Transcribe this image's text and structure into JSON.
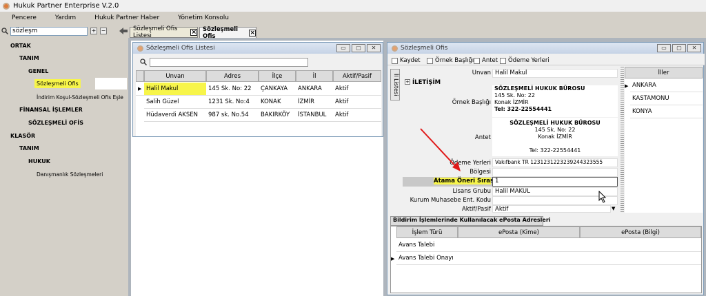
{
  "app": {
    "title": "Hukuk Partner Enterprise V.2.0"
  },
  "menu": [
    "Pencere",
    "Yardım",
    "Hukuk Partner Haber",
    "Yönetim Konsolu"
  ],
  "sidebar": {
    "search_value": "sözleşm",
    "expand_label": "+",
    "collapse_label": "−",
    "tree": [
      {
        "label": "ORTAK"
      },
      {
        "label": "TANIM"
      },
      {
        "label": "GENEL"
      },
      {
        "label": "Sözleşmeli Ofis"
      },
      {
        "label": "İndirim Koşul-Sözleşmeli Ofis Eşle"
      },
      {
        "label": "FİNANSAL İŞLEMLER"
      },
      {
        "label": "SÖZLEŞMELİ OFİS"
      },
      {
        "label": "KLASÖR"
      },
      {
        "label": "TANIM"
      },
      {
        "label": "HUKUK"
      },
      {
        "label": "Danışmanlık Sözleşmeleri"
      }
    ]
  },
  "tabs": [
    {
      "label": "Sözleşmeli Ofis Listesi"
    },
    {
      "label": "Sözleşmeli Ofis"
    }
  ],
  "list_window": {
    "title": "Sözleşmeli Ofis Listesi",
    "columns": [
      "Unvan",
      "Adres",
      "İlçe",
      "İl",
      "Aktif/Pasif"
    ],
    "rows": [
      [
        "Halil Makul",
        "145 Sk. No: 22",
        "ÇANKAYA",
        "ANKARA",
        "Aktif"
      ],
      [
        "Salih Güzel",
        "1231 Sk. No:4",
        "KONAK",
        "İZMİR",
        "Aktif"
      ],
      [
        "Hüdaverdi AKSEN",
        "987 sk. No.54",
        "BAKIRKÖY",
        "İSTANBUL",
        "Aktif"
      ]
    ]
  },
  "detail_window": {
    "title": "Sözleşmeli Ofis",
    "toolbar": [
      "Kaydet",
      "Örnek Başlığı",
      "Antet",
      "Ödeme Yerleri"
    ],
    "side_tab": "İl Listesi",
    "section": "İLETİŞİM",
    "expand": "+",
    "fields": {
      "unvan": {
        "label": "Unvan",
        "value": "Halil Makul"
      },
      "ornek": {
        "label": "Örnek Başlığı",
        "lines": [
          "SÖZLEŞMELİ HUKUK BÜROSU",
          "145 Sk. No: 22",
          "Konak İZMİR",
          "Tel: 322-22554441"
        ]
      },
      "antet": {
        "label": "Antet",
        "lines": [
          "SÖZLEŞMELİ HUKUK BÜROSU",
          "145 Sk. No: 22",
          "Konak İZMİR",
          "",
          "Tel: 322-22554441"
        ]
      },
      "odeme": {
        "label": "Ödeme Yerleri",
        "value": "Vakıfbank TR 1231231223239244323555"
      },
      "bolgesi": {
        "label": "Bölgesi",
        "value": ""
      },
      "atama": {
        "label": "Atama Öneri Sırası",
        "value": "1"
      },
      "lisans": {
        "label": "Lisans Grubu",
        "value": "Halil MAKUL"
      },
      "kurum": {
        "label": "Kurum Muhasebe Ent. Kodu",
        "value": ""
      },
      "aktif": {
        "label": "Aktif/Pasif",
        "value": "Aktif"
      }
    },
    "iller": {
      "header": "İller",
      "items": [
        "ANKARA",
        "KASTAMONU",
        "KONYA"
      ]
    },
    "email_tab": "Bildirim İşlemlerinde Kullanılacak ePosta Adresleri",
    "email_columns": [
      "İşlem Türü",
      "ePosta (Kime)",
      "ePosta (Bilgi)"
    ],
    "email_rows": [
      [
        "Avans Talebi",
        "",
        ""
      ],
      [
        "Avans Talebi Onayı",
        "",
        ""
      ]
    ]
  },
  "colors": {
    "highlight": "#f7f54a",
    "arrow": "#e01919"
  }
}
